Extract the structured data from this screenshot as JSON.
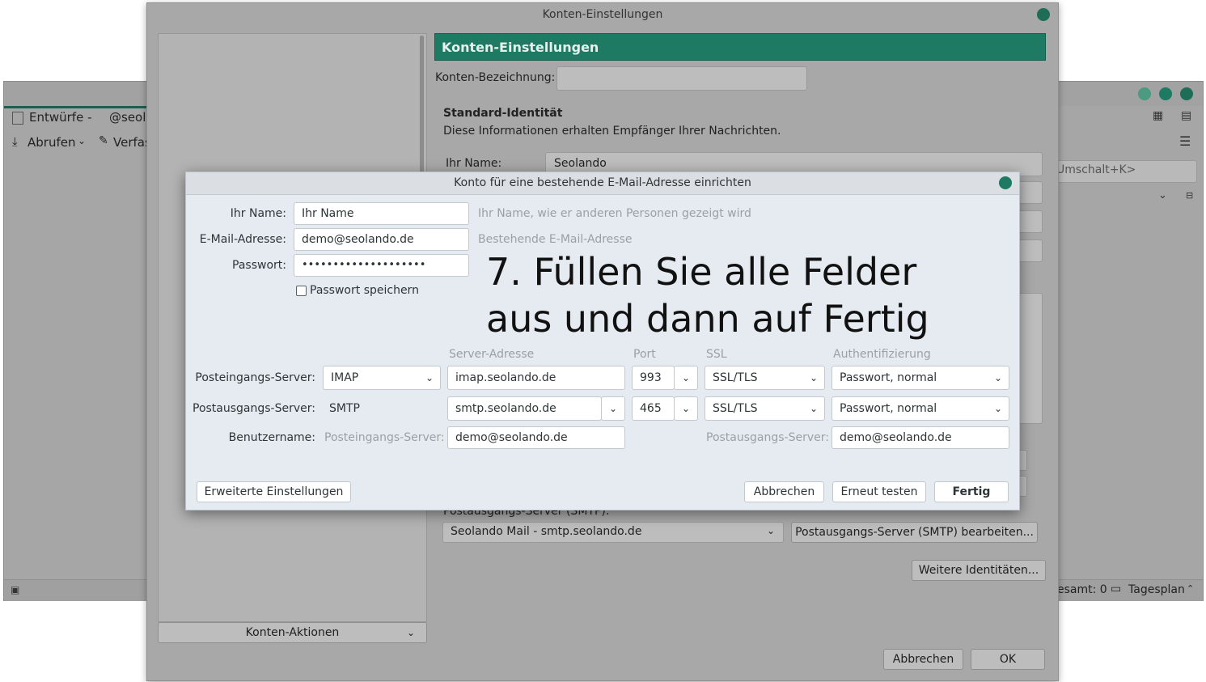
{
  "main_window": {
    "drafts_label": "Entwürfe -",
    "account_partial": "@seola",
    "fetch_label": "Abrufen",
    "compose_label": "Verfas",
    "search_hint": "Umschalt+K>",
    "status_total": "esamt: 0",
    "today_pane": "Tagesplan"
  },
  "settings": {
    "window_title": "Konten-Einstellungen",
    "header": "Konten-Einstellungen",
    "account_name_label": "Konten-Bezeichnung:",
    "account_name_value": "",
    "identity_title": "Standard-Identität",
    "identity_desc": "Diese Informationen erhalten Empfänger Ihrer Nachrichten.",
    "your_name_label": "Ihr Name:",
    "your_name_value": "Seolando",
    "smtp_label": "Postausgangs-Server (SMTP):",
    "smtp_value": "Seolando Mail - smtp.seolando.de",
    "smtp_edit_button": "Postausgangs-Server (SMTP) bearbeiten...",
    "more_identities_button": "Weitere Identitäten...",
    "account_actions": "Konten-Aktionen",
    "cancel_button": "Abbrechen",
    "ok_button": "OK"
  },
  "dialog": {
    "title": "Konto für eine bestehende E-Mail-Adresse einrichten",
    "name_label": "Ihr Name:",
    "name_value": "Ihr Name",
    "name_hint": "Ihr Name, wie er anderen Personen gezeigt wird",
    "email_label": "E-Mail-Adresse:",
    "email_value": "demo@seolando.de",
    "email_hint": "Bestehende E-Mail-Adresse",
    "password_label": "Passwort:",
    "password_value": "••••••••••••••••••••",
    "remember_password": "Passwort speichern",
    "remember_checked": false,
    "instruction_line1": "7. Füllen Sie alle Felder",
    "instruction_line2": "aus und dann auf Fertig",
    "col_server": "Server-Adresse",
    "col_port": "Port",
    "col_ssl": "SSL",
    "col_auth": "Authentifizierung",
    "incoming_label": "Posteingangs-Server:",
    "incoming_protocol": "IMAP",
    "incoming_server": "imap.seolando.de",
    "incoming_port": "993",
    "incoming_ssl": "SSL/TLS",
    "incoming_auth": "Passwort, normal",
    "outgoing_label": "Postausgangs-Server:",
    "outgoing_protocol": "SMTP",
    "outgoing_server": "smtp.seolando.de",
    "outgoing_port": "465",
    "outgoing_ssl": "SSL/TLS",
    "outgoing_auth": "Passwort, normal",
    "username_label": "Benutzername:",
    "username_in_label": "Posteingangs-Server:",
    "username_in_value": "demo@seolando.de",
    "username_out_label": "Postausgangs-Server:",
    "username_out_value": "demo@seolando.de",
    "advanced_button": "Erweiterte Einstellungen",
    "cancel_button": "Abbrechen",
    "retest_button": "Erneut testen",
    "done_button": "Fertig"
  },
  "colors": {
    "accent": "#1e7a62",
    "dim_bg": "#a8a8a8",
    "dialog_bg": "#e5ebf0"
  }
}
